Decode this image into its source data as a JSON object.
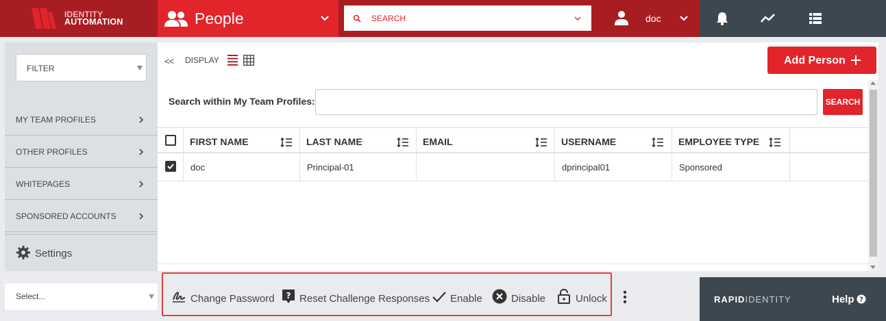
{
  "header": {
    "logo_line1": "IDENTITY",
    "logo_line2": "AUTOMATION",
    "module_title": "People",
    "search_placeholder": "SEARCH",
    "username": "doc",
    "icons": [
      "bell-icon",
      "activity-icon",
      "list-icon"
    ]
  },
  "sidebar": {
    "filter_label": "FILTER",
    "items": [
      {
        "label": "MY TEAM PROFILES"
      },
      {
        "label": "OTHER PROFILES"
      },
      {
        "label": "WHITEPAGES"
      },
      {
        "label": "SPONSORED ACCOUNTS"
      }
    ],
    "settings_label": "Settings",
    "select_label": "Select..."
  },
  "main": {
    "back_label": "<<",
    "display_label": "DISPLAY",
    "add_person_label": "Add Person",
    "search_within_label": "Search within My Team Profiles:",
    "search_button_label": "SEARCH",
    "columns": [
      "FIRST NAME",
      "LAST NAME",
      "EMAIL",
      "USERNAME",
      "EMPLOYEE TYPE"
    ],
    "rows": [
      {
        "checked": true,
        "first_name": "doc",
        "last_name": "Principal-01",
        "email": "",
        "username": "dprincipal01",
        "employee_type": "Sponsored"
      }
    ]
  },
  "actions": {
    "change_password": "Change Password",
    "reset_challenge": "Reset Challenge Responses",
    "enable": "Enable",
    "disable": "Disable",
    "unlock": "Unlock"
  },
  "footer": {
    "brand_a": "RAPID",
    "brand_b": "IDENTITY",
    "help_label": "Help"
  },
  "colors": {
    "brand_red": "#e2242b",
    "brand_dark_red": "#a81d22",
    "slate": "#3d4750"
  }
}
